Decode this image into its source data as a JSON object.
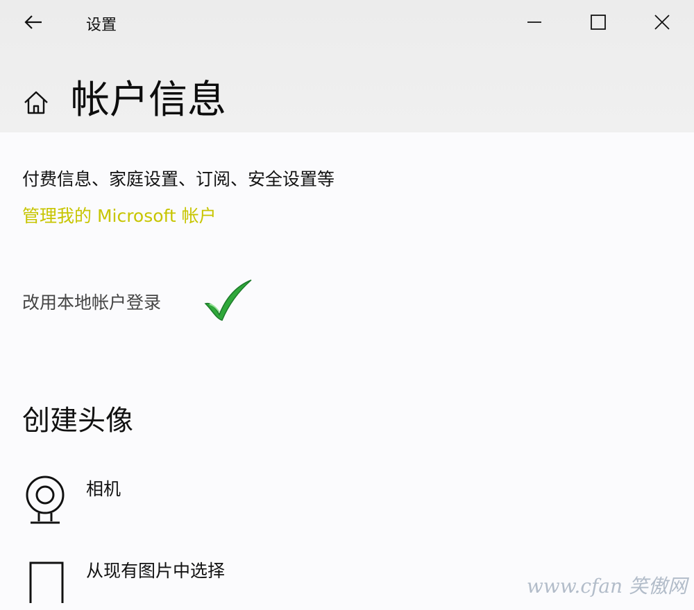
{
  "window": {
    "app_title": "设置",
    "icons": {
      "back": "back-arrow-icon",
      "minimize": "minimize-icon",
      "maximize": "maximize-icon",
      "close": "close-icon",
      "home": "home-icon"
    }
  },
  "page": {
    "title": "帐户信息"
  },
  "account": {
    "description": "付费信息、家庭设置、订阅、安全设置等",
    "manage_link": "管理我的 Microsoft 帐户",
    "local_signin_link": "改用本地帐户登录",
    "annotation_icon": "green-checkmark-icon"
  },
  "create_avatar": {
    "title": "创建头像",
    "items": [
      {
        "label": "相机",
        "icon": "webcam-icon"
      },
      {
        "label": "从现有图片中选择",
        "icon": "picture-frame-icon"
      }
    ]
  },
  "watermark": {
    "text": "www.cfan 笑傲网"
  },
  "colors": {
    "header_band": "#ececec",
    "background": "#fbfbfd",
    "link_highlight": "#c7c500",
    "checkmark_green": "#2fa83a"
  }
}
